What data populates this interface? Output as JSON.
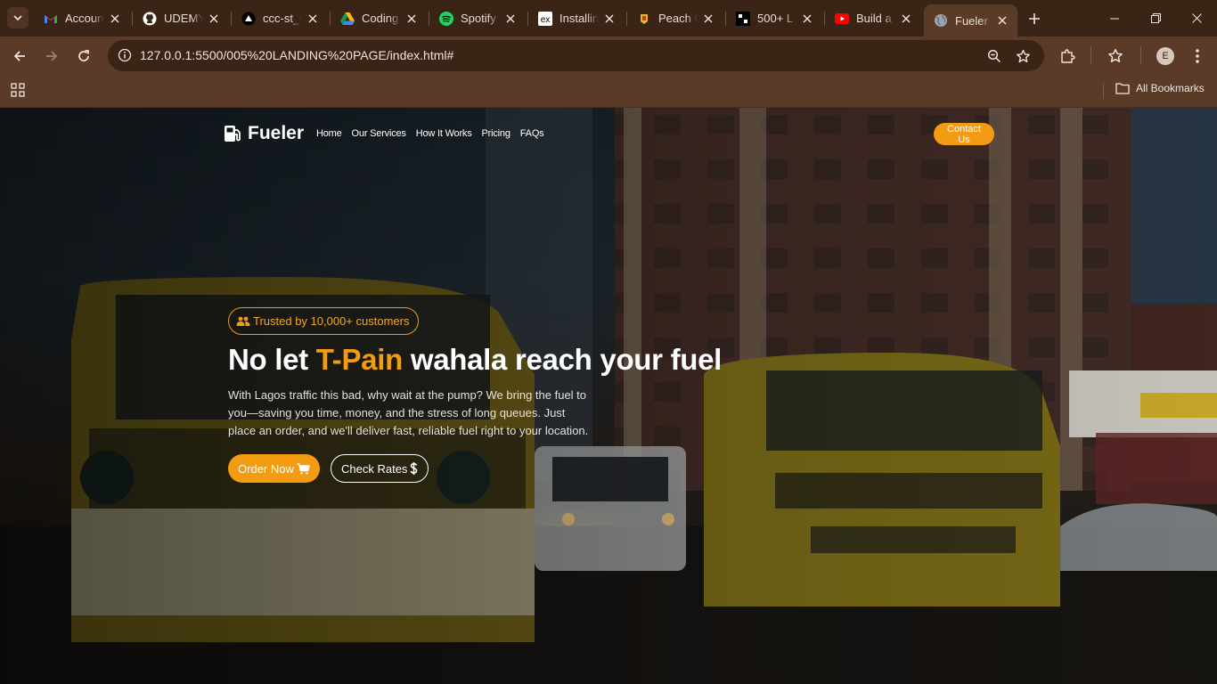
{
  "browser": {
    "tabs": [
      {
        "label": "Accoun",
        "icon": "gmail-icon"
      },
      {
        "label": "UDEMY",
        "icon": "github-icon"
      },
      {
        "label": "ccc-st_s",
        "icon": "vercel-icon"
      },
      {
        "label": "Coding",
        "icon": "google-drive-icon"
      },
      {
        "label": "Spotify",
        "icon": "spotify-icon"
      },
      {
        "label": "Installin",
        "icon": "ex-icon"
      },
      {
        "label": "Peach C",
        "icon": "peach-icon"
      },
      {
        "label": "500+ L",
        "icon": "dark-site-icon"
      },
      {
        "label": "Build a",
        "icon": "youtube-icon"
      },
      {
        "label": "Fueler",
        "icon": "globe-icon",
        "active": true
      }
    ],
    "url": "127.0.0.1:5500/005%20LANDING%20PAGE/index.html#",
    "profile_initial": "E",
    "bookmarks_label": "All Bookmarks",
    "colors": {
      "frame": "#3a2416",
      "toolbar": "#5a3b28"
    }
  },
  "site": {
    "logo_text": "Fueler",
    "nav": [
      "Home",
      "Our Services",
      "How It Works",
      "Pricing",
      "FAQs"
    ],
    "contact_label": "Contact Us",
    "badge_text": "Trusted by 10,000+ customers",
    "headline": {
      "before": "No let ",
      "accent": "T-Pain",
      "after": " wahala reach your fuel"
    },
    "description": "With Lagos traffic this bad, why wait at the pump? We bring the fuel to you—saving you time, money, and the stress of long queues. Just place an order, and we'll deliver fast, reliable fuel right to your location.",
    "order_label": "Order Now",
    "rates_label": "Check Rates",
    "colors": {
      "accent": "#f39c12",
      "text": "#ffffff"
    }
  }
}
